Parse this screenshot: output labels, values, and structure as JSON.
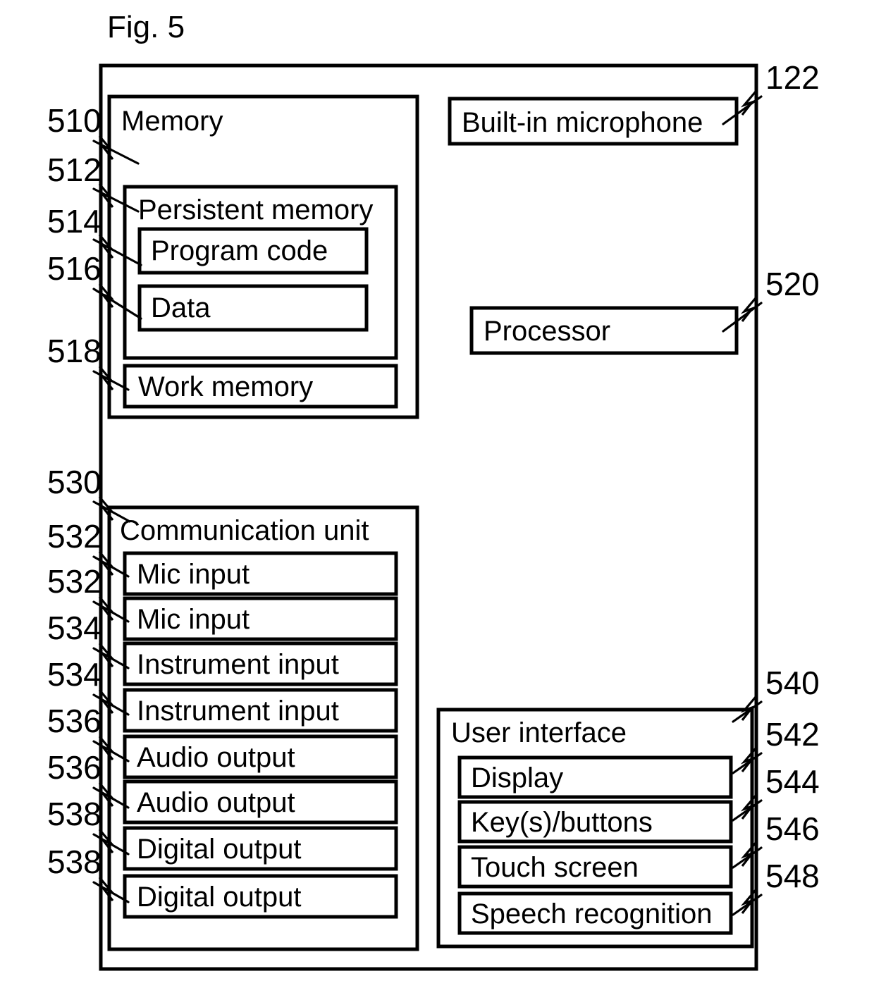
{
  "figure": {
    "title": "Fig. 5"
  },
  "device": {
    "outer_box_name": "device-enclosure"
  },
  "memory": {
    "label": "Memory",
    "ref": "510",
    "persistent": {
      "label": "Persistent memory",
      "ref": "512",
      "items": [
        {
          "label": "Program code",
          "ref": "514"
        },
        {
          "label": "Data",
          "ref": "516"
        }
      ]
    },
    "work_memory": {
      "label": "Work memory",
      "ref": "518"
    }
  },
  "microphone": {
    "label": "Built-in microphone",
    "ref": "122"
  },
  "processor": {
    "label": "Processor",
    "ref": "520"
  },
  "communication_unit": {
    "label": "Communication unit",
    "ref": "530",
    "ports": [
      {
        "label": "Mic input",
        "ref": "532"
      },
      {
        "label": "Mic input",
        "ref": "532"
      },
      {
        "label": "Instrument input",
        "ref": "534"
      },
      {
        "label": "Instrument input",
        "ref": "534"
      },
      {
        "label": "Audio output",
        "ref": "536"
      },
      {
        "label": "Audio output",
        "ref": "536"
      },
      {
        "label": "Digital output",
        "ref": "538"
      },
      {
        "label": "Digital output",
        "ref": "538"
      }
    ]
  },
  "user_interface": {
    "label": "User interface",
    "ref": "540",
    "items": [
      {
        "label": "Display",
        "ref": "542"
      },
      {
        "label": "Key(s)/buttons",
        "ref": "544"
      },
      {
        "label": "Touch screen",
        "ref": "546"
      },
      {
        "label": "Speech recognition",
        "ref": "548"
      }
    ]
  },
  "colors": {
    "ink": "#000000",
    "paper": "#ffffff"
  }
}
